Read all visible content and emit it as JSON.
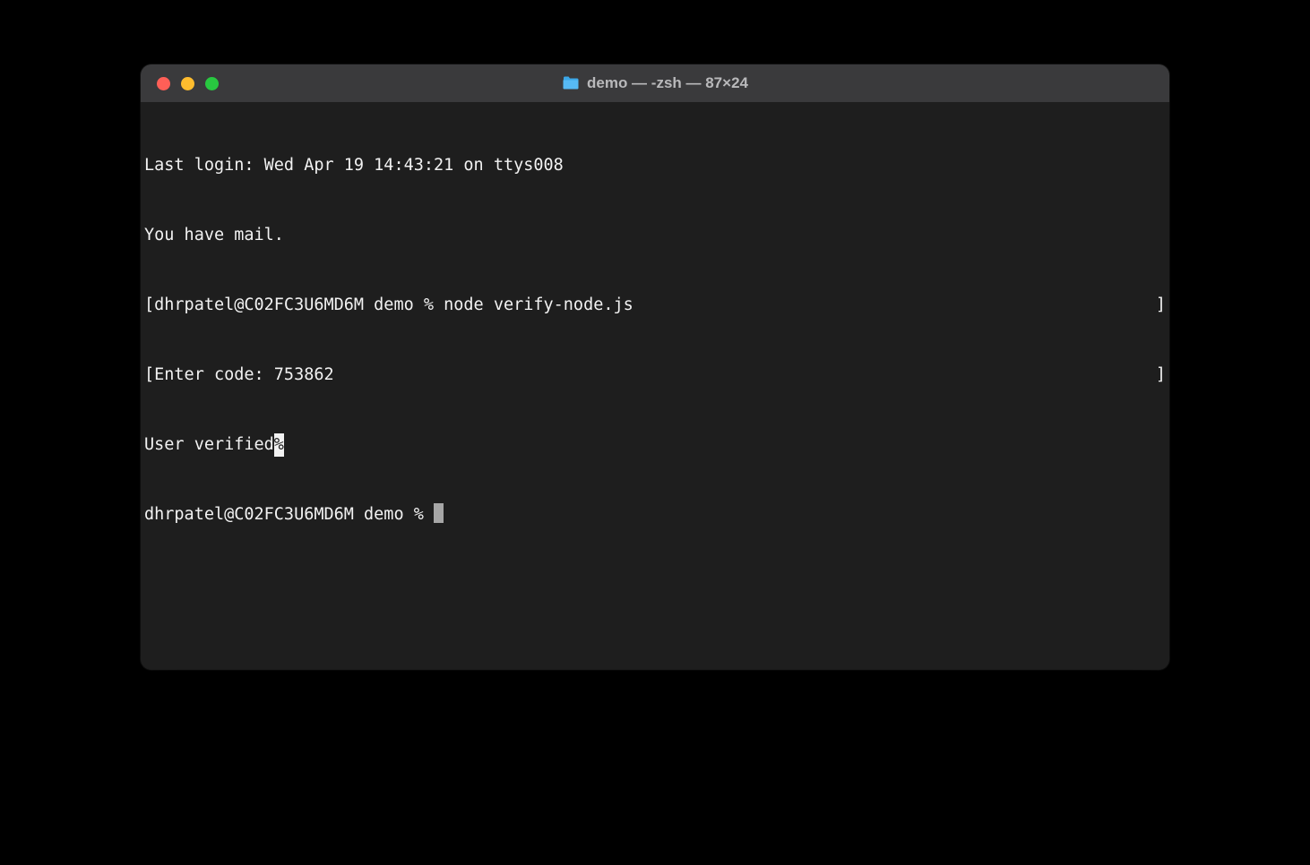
{
  "window": {
    "title": "demo — -zsh — 87×24"
  },
  "terminal": {
    "line0": "Last login: Wed Apr 19 14:43:21 on ttys008",
    "line1": "You have mail.",
    "line2_left": "[dhrpatel@C02FC3U6MD6M demo % node verify-node.js",
    "line2_right": "]",
    "line3_left": "[Enter code: 753862",
    "line3_right": "]",
    "line4_text": "User verified",
    "line4_mark": "%",
    "line5_prompt": "dhrpatel@C02FC3U6MD6M demo % "
  }
}
